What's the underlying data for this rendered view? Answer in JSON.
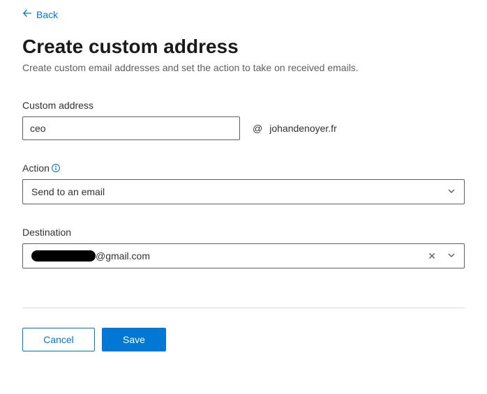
{
  "back": {
    "label": "Back"
  },
  "header": {
    "title": "Create custom address",
    "subtitle": "Create custom email addresses and set the action to take on received emails."
  },
  "custom_address": {
    "label": "Custom address",
    "value": "ceo",
    "at": "@",
    "domain": "johandenoyer.fr"
  },
  "action": {
    "label": "Action",
    "selected": "Send to an email"
  },
  "destination": {
    "label": "Destination",
    "suffix": "@gmail.com"
  },
  "buttons": {
    "cancel": "Cancel",
    "save": "Save"
  }
}
